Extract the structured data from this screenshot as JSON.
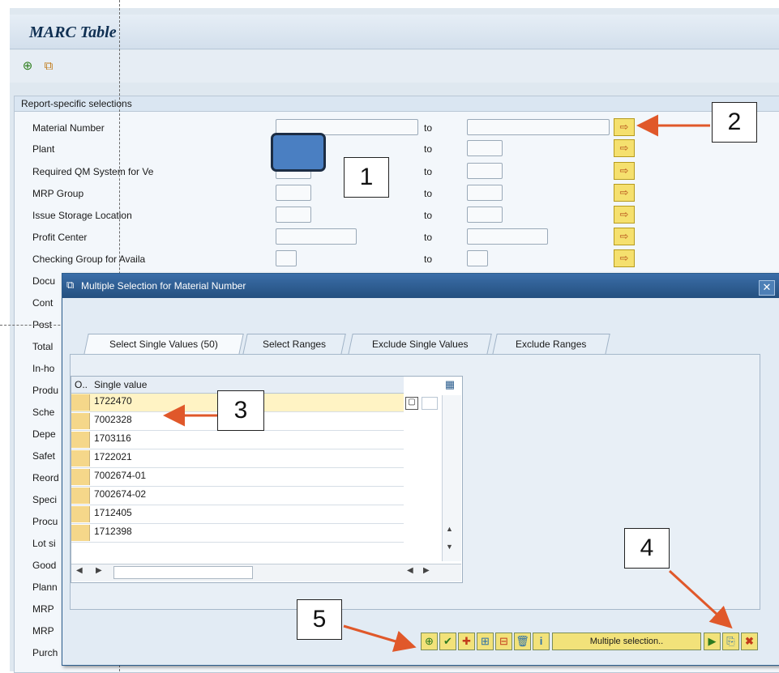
{
  "window": {
    "title": "MARC Table",
    "toolbar": [
      {
        "icon": "execute-icon",
        "glyph": "⊕"
      },
      {
        "icon": "get-variant-icon",
        "glyph": "⧉"
      }
    ]
  },
  "selections": {
    "section_title": "Report-specific selections",
    "to_label": "to",
    "fields": [
      {
        "label": "Material Number",
        "from_value": "",
        "to_value": ""
      },
      {
        "label": "Plant",
        "from_value": "",
        "to_value": ""
      },
      {
        "label": "Required QM System for Ve",
        "from_value": "",
        "to_value": ""
      },
      {
        "label": "MRP Group",
        "from_value": "",
        "to_value": ""
      },
      {
        "label": "Issue Storage Location",
        "from_value": "",
        "to_value": ""
      },
      {
        "label": "Profit Center",
        "from_value": "",
        "to_value": ""
      },
      {
        "label": "Checking Group for Availa",
        "from_value": "",
        "to_value": ""
      }
    ],
    "truncated_labels": [
      "Docu",
      "Cont",
      "Post",
      "Total",
      "In-ho",
      "Produ",
      "Sche",
      "Depe",
      "Safet",
      "Reord",
      "Speci",
      "Procu",
      "Lot si",
      "Good",
      "Plann",
      "MRP",
      "MRP",
      "Purch"
    ]
  },
  "callouts": [
    "1",
    "2",
    "3",
    "4",
    "5"
  ],
  "dialog": {
    "title": "Multiple Selection for Material Number",
    "close_glyph": "✕",
    "tabs": [
      "Select Single Values (50)",
      "Select Ranges",
      "Exclude Single Values",
      "Exclude Ranges"
    ],
    "grid": {
      "col_option": "O..",
      "col_value": "Single value",
      "rows": [
        "1722470",
        "7002328",
        "1703116",
        "1722021",
        "7002674-01",
        "7002674-02",
        "1712405",
        "1712398"
      ]
    },
    "buttons": {
      "multiple_selection": "Multiple selection.."
    }
  },
  "colors": {
    "sap_title": "#0f2f52",
    "dialog_titlebar": "#24507f",
    "button_yellow": "#f5e06e",
    "plant_highlight": "#4a7fc2",
    "arrow": "#e0582a"
  }
}
